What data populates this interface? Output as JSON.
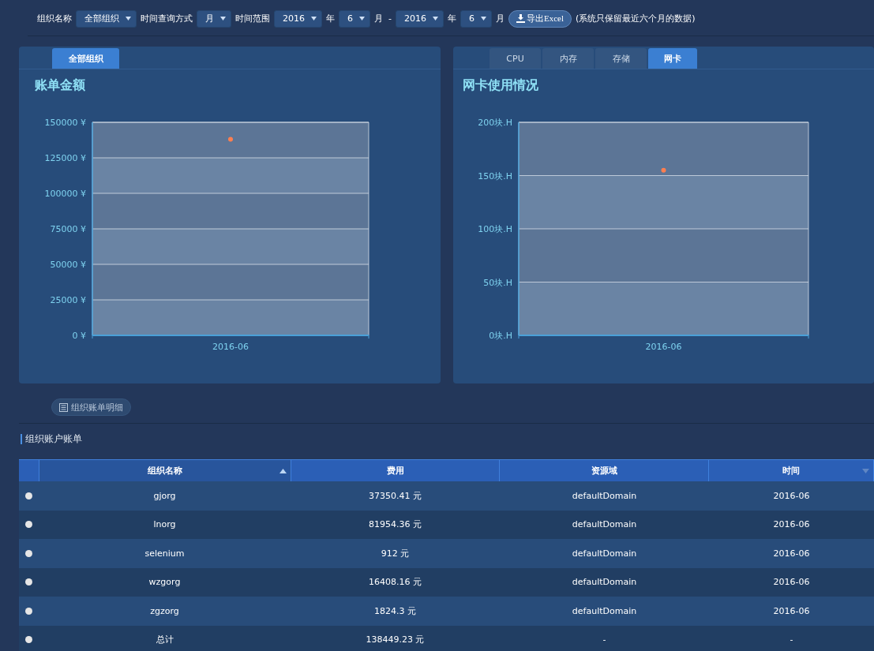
{
  "filters": [
    {
      "kind": "label",
      "text": "组织名称"
    },
    {
      "kind": "select",
      "text": "全部组织"
    },
    {
      "kind": "label",
      "text": "时间查询方式"
    },
    {
      "kind": "select",
      "text": "月"
    },
    {
      "kind": "label",
      "text": "时间范围"
    },
    {
      "kind": "select",
      "text": "2016"
    },
    {
      "kind": "label",
      "text": "年"
    },
    {
      "kind": "select",
      "text": "6"
    },
    {
      "kind": "label",
      "text": "月"
    },
    {
      "kind": "label",
      "text": "-"
    },
    {
      "kind": "select",
      "text": "2016"
    },
    {
      "kind": "label",
      "text": "年"
    },
    {
      "kind": "select",
      "text": "6"
    },
    {
      "kind": "label",
      "text": "月"
    },
    {
      "kind": "button",
      "text": "导出Excel"
    },
    {
      "kind": "label",
      "text": "(系统只保留最近六个月的数据)"
    }
  ],
  "panels": [
    {
      "tabs": [
        {
          "label": "全部组织",
          "selected": true
        }
      ],
      "chart_data": {
        "type": "scatter",
        "title": "账单金额",
        "categories": [
          "2016-06"
        ],
        "series": [
          {
            "values": [
              138000
            ]
          }
        ],
        "ylim": [
          0,
          150000
        ],
        "grid": true,
        "yticks": [
          {
            "value": 0,
            "label": "0 ¥"
          },
          {
            "value": 25000,
            "label": "25000 ¥"
          },
          {
            "value": 50000,
            "label": "50000 ¥"
          },
          {
            "value": 75000,
            "label": "75000 ¥"
          },
          {
            "value": 100000,
            "label": "100000 ¥"
          },
          {
            "value": 125000,
            "label": "125000 ¥"
          },
          {
            "value": 150000,
            "label": "150000 ¥"
          }
        ]
      }
    },
    {
      "tabs": [
        {
          "label": "CPU",
          "selected": false
        },
        {
          "label": "内存",
          "selected": false
        },
        {
          "label": "存储",
          "selected": false
        },
        {
          "label": "网卡",
          "selected": true
        }
      ],
      "chart_data": {
        "type": "scatter",
        "title": "网卡使用情况",
        "categories": [
          "2016-06"
        ],
        "series": [
          {
            "values": [
              155
            ]
          }
        ],
        "ylim": [
          0,
          200
        ],
        "grid": true,
        "yticks": [
          {
            "value": 0,
            "label": "0块.H"
          },
          {
            "value": 50,
            "label": "50块.H"
          },
          {
            "value": 100,
            "label": "100块.H"
          },
          {
            "value": 150,
            "label": "150块.H"
          },
          {
            "value": 200,
            "label": "200块.H"
          }
        ]
      }
    }
  ],
  "detail_button": "组织账单明细",
  "section_title": "组织账户账单",
  "table": {
    "columns": [
      {
        "label": "组织名称",
        "sorted": true,
        "menu": false
      },
      {
        "label": "费用",
        "sorted": false,
        "menu": false
      },
      {
        "label": "资源域",
        "sorted": false,
        "menu": false
      },
      {
        "label": "时间",
        "sorted": false,
        "menu": true
      }
    ],
    "rows": [
      {
        "selected": false,
        "cells": [
          "gjorg",
          "37350.41 元",
          "defaultDomain",
          "2016-06"
        ]
      },
      {
        "selected": false,
        "cells": [
          "lnorg",
          "81954.36 元",
          "defaultDomain",
          "2016-06"
        ]
      },
      {
        "selected": false,
        "cells": [
          "selenium",
          "912 元",
          "defaultDomain",
          "2016-06"
        ]
      },
      {
        "selected": false,
        "cells": [
          "wzgorg",
          "16408.16 元",
          "defaultDomain",
          "2016-06"
        ]
      },
      {
        "selected": false,
        "cells": [
          "zgzorg",
          "1824.3 元",
          "defaultDomain",
          "2016-06"
        ]
      },
      {
        "selected": false,
        "cells": [
          "总计",
          "138449.23 元",
          "-",
          "-"
        ]
      }
    ]
  }
}
